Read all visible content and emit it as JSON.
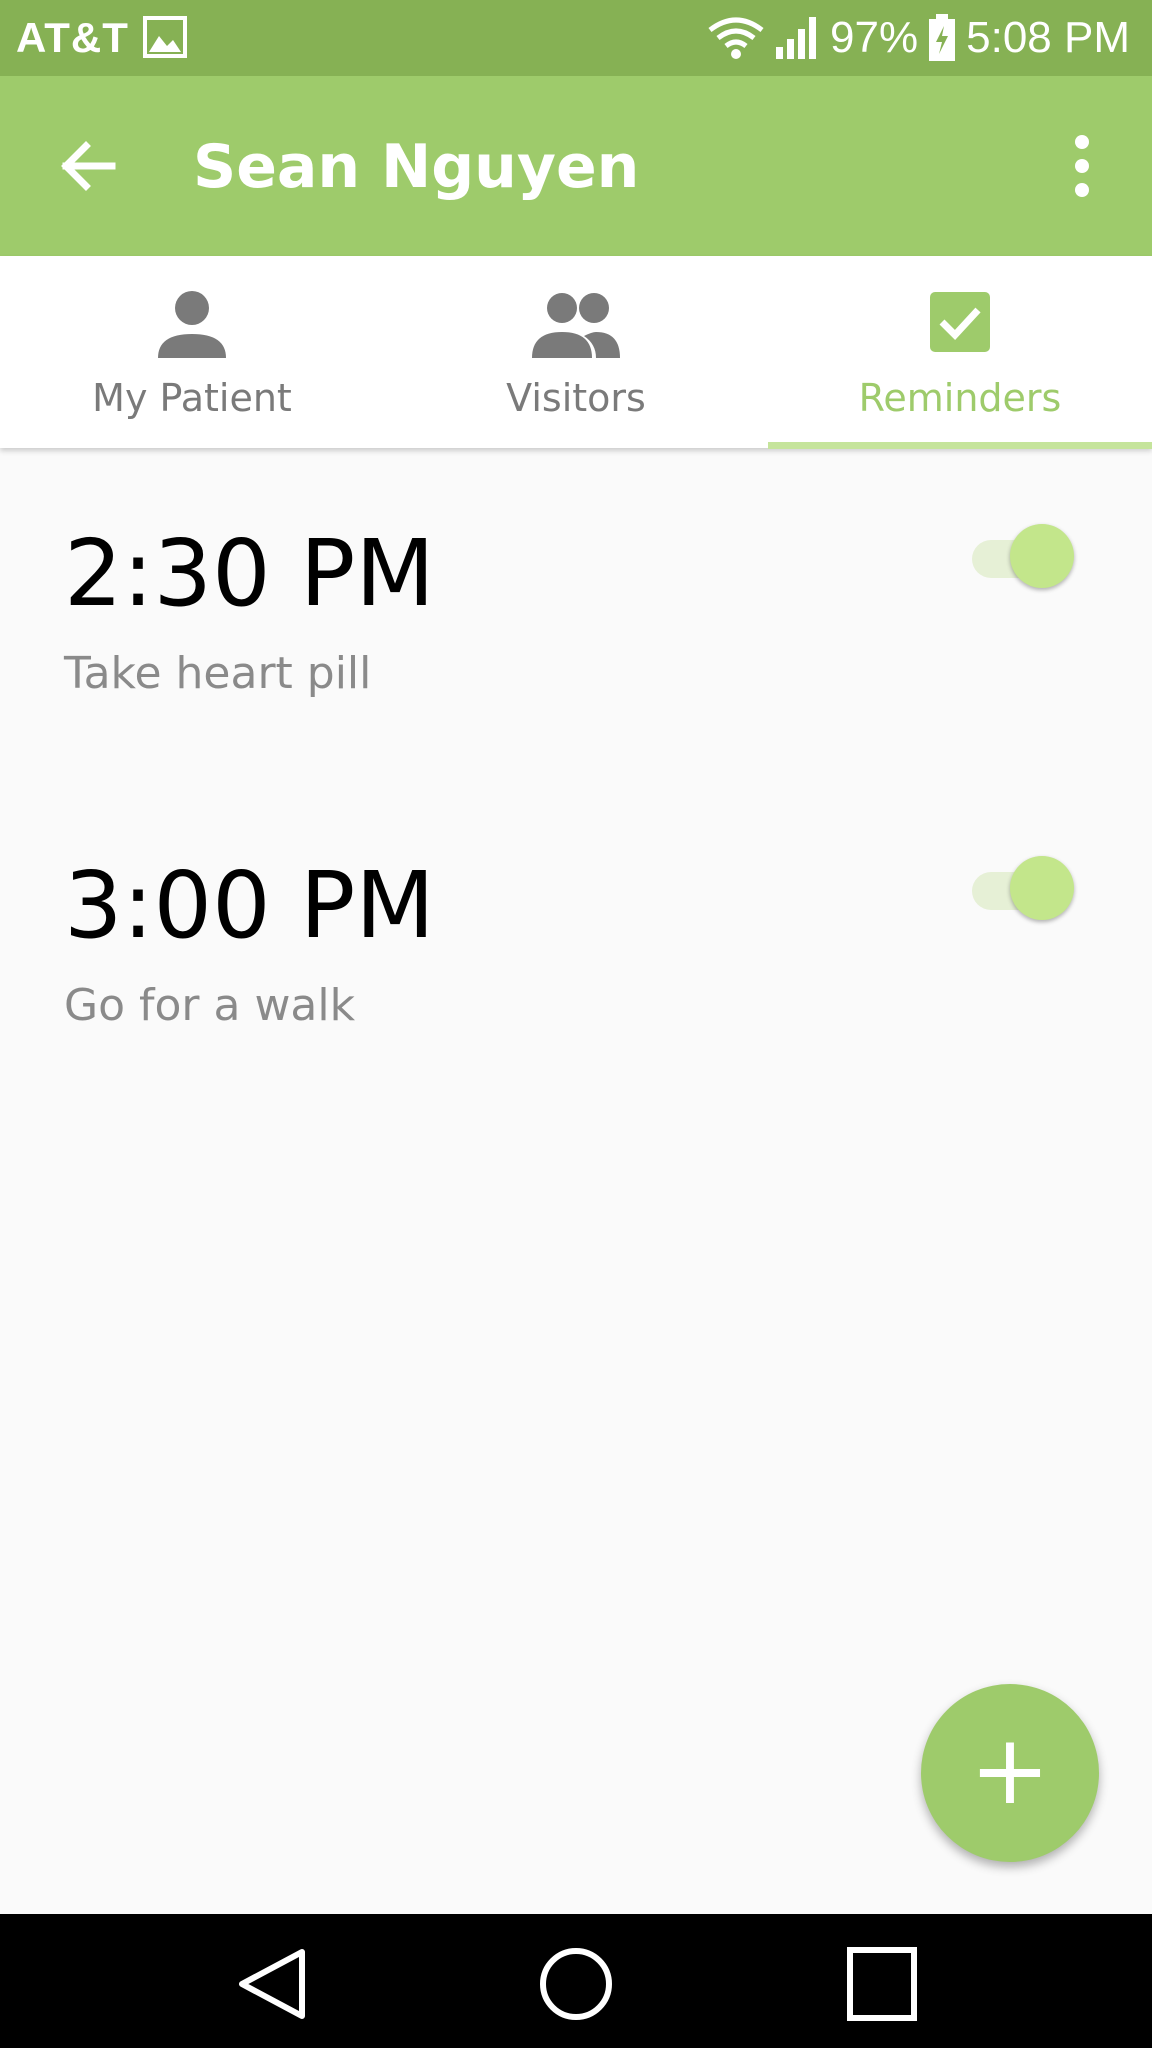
{
  "status_bar": {
    "carrier": "AT&T",
    "battery": "97%",
    "time": "5:08 PM"
  },
  "app_bar": {
    "title": "Sean Nguyen"
  },
  "tabs": [
    {
      "label": "My Patient",
      "icon": "person-icon",
      "active": false
    },
    {
      "label": "Visitors",
      "icon": "people-icon",
      "active": false
    },
    {
      "label": "Reminders",
      "icon": "checkbox-icon",
      "active": true
    }
  ],
  "reminders": [
    {
      "time": "2:30 PM",
      "description": "Take heart pill",
      "enabled": true
    },
    {
      "time": "3:00 PM",
      "description": "Go for a walk",
      "enabled": true
    }
  ],
  "fab": {
    "label": "+"
  },
  "colors": {
    "status_bar": "#86b154",
    "primary": "#9ecb6b",
    "tab_inactive": "#7a7a7a"
  }
}
